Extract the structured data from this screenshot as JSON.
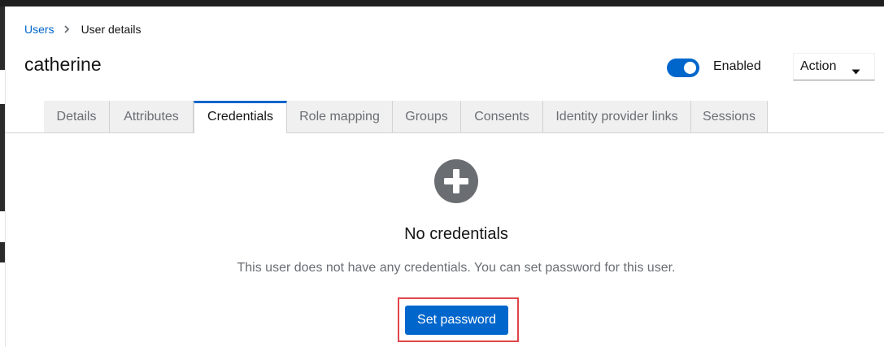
{
  "breadcrumb": {
    "parent": "Users",
    "current": "User details"
  },
  "header": {
    "title": "catherine",
    "toggle_label": "Enabled",
    "toggle_on": true,
    "action_label": "Action"
  },
  "tabs": [
    {
      "label": "Details",
      "active": false
    },
    {
      "label": "Attributes",
      "active": false
    },
    {
      "label": "Credentials",
      "active": true
    },
    {
      "label": "Role mapping",
      "active": false
    },
    {
      "label": "Groups",
      "active": false
    },
    {
      "label": "Consents",
      "active": false
    },
    {
      "label": "Identity provider links",
      "active": false
    },
    {
      "label": "Sessions",
      "active": false
    }
  ],
  "empty_state": {
    "icon": "plus-circle-icon",
    "title": "No credentials",
    "body": "This user does not have any credentials. You can set password for this user.",
    "button_label": "Set password"
  },
  "colors": {
    "accent": "#0066cc",
    "highlight": "#e0454a",
    "tab_inactive_bg": "#f0f0f0",
    "icon_gray": "#6a6e73"
  }
}
